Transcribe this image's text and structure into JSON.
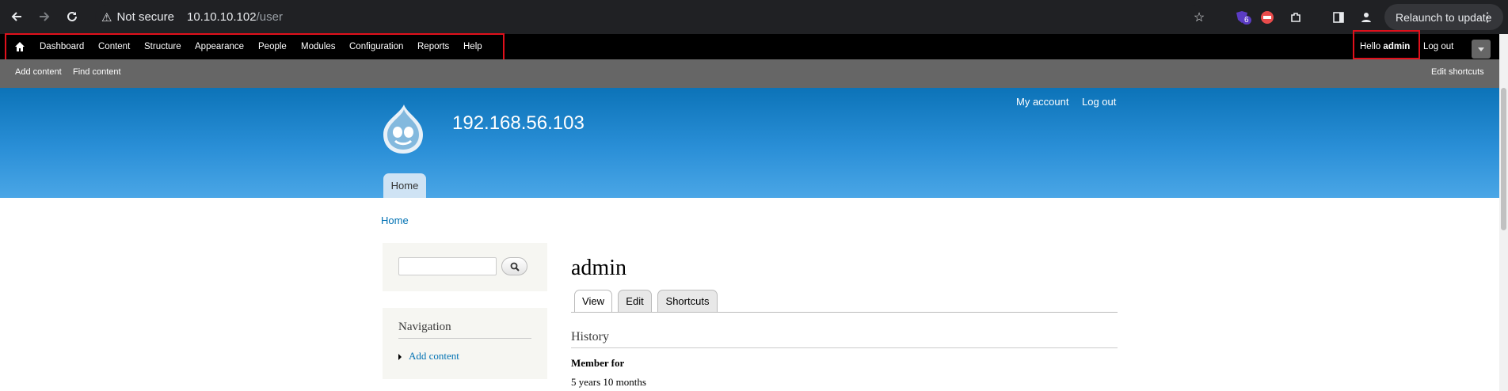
{
  "browser": {
    "security_label": "Not secure",
    "url_host": "10.10.10.102",
    "url_path": "/user",
    "relaunch_label": "Relaunch to update",
    "extension_badge": "6"
  },
  "toolbar": {
    "items": [
      "Dashboard",
      "Content",
      "Structure",
      "Appearance",
      "People",
      "Modules",
      "Configuration",
      "Reports",
      "Help"
    ],
    "hello_prefix": "Hello",
    "username": "admin",
    "logout_label": "Log out"
  },
  "shortcuts": {
    "items": [
      "Add content",
      "Find content"
    ],
    "edit_label": "Edit shortcuts"
  },
  "header": {
    "site_name": "192.168.56.103",
    "secondary_menu": [
      "My account",
      "Log out"
    ],
    "main_menu_tab": "Home"
  },
  "breadcrumb": "Home",
  "sidebar": {
    "search_value": "",
    "navigation_title": "Navigation",
    "navigation_items": [
      "Add content"
    ]
  },
  "main": {
    "title": "admin",
    "tabs": [
      "View",
      "Edit",
      "Shortcuts"
    ],
    "active_tab": "View",
    "section_title": "History",
    "field_label": "Member for",
    "field_value": "5 years 10 months"
  },
  "colors": {
    "highlight_box": "#e0101b",
    "link": "#0071b3",
    "header_top": "#0c73b8",
    "header_bottom": "#4aa6e6"
  }
}
